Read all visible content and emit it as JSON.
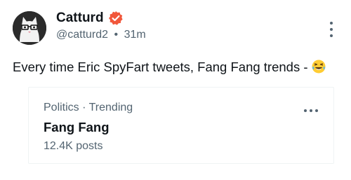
{
  "author": {
    "name": "Catturd",
    "handle": "@catturd2",
    "separator": "•",
    "time": "31m"
  },
  "tweet": {
    "text": "Every time Eric SpyFart tweets, Fang Fang trends - ",
    "emoji": "face-with-tears-of-joy"
  },
  "trend_card": {
    "context": "Politics · Trending",
    "name": "Fang Fang",
    "post_count": "12.4K posts"
  },
  "colors": {
    "text_primary": "#0f1419",
    "text_secondary": "#536471",
    "verified_badge": "#f1573b",
    "card_border": "#eff3f4"
  },
  "icons": {
    "verified": "verified-badge-icon",
    "more_options": "more-vertical-icon",
    "card_more": "more-horizontal-icon"
  }
}
